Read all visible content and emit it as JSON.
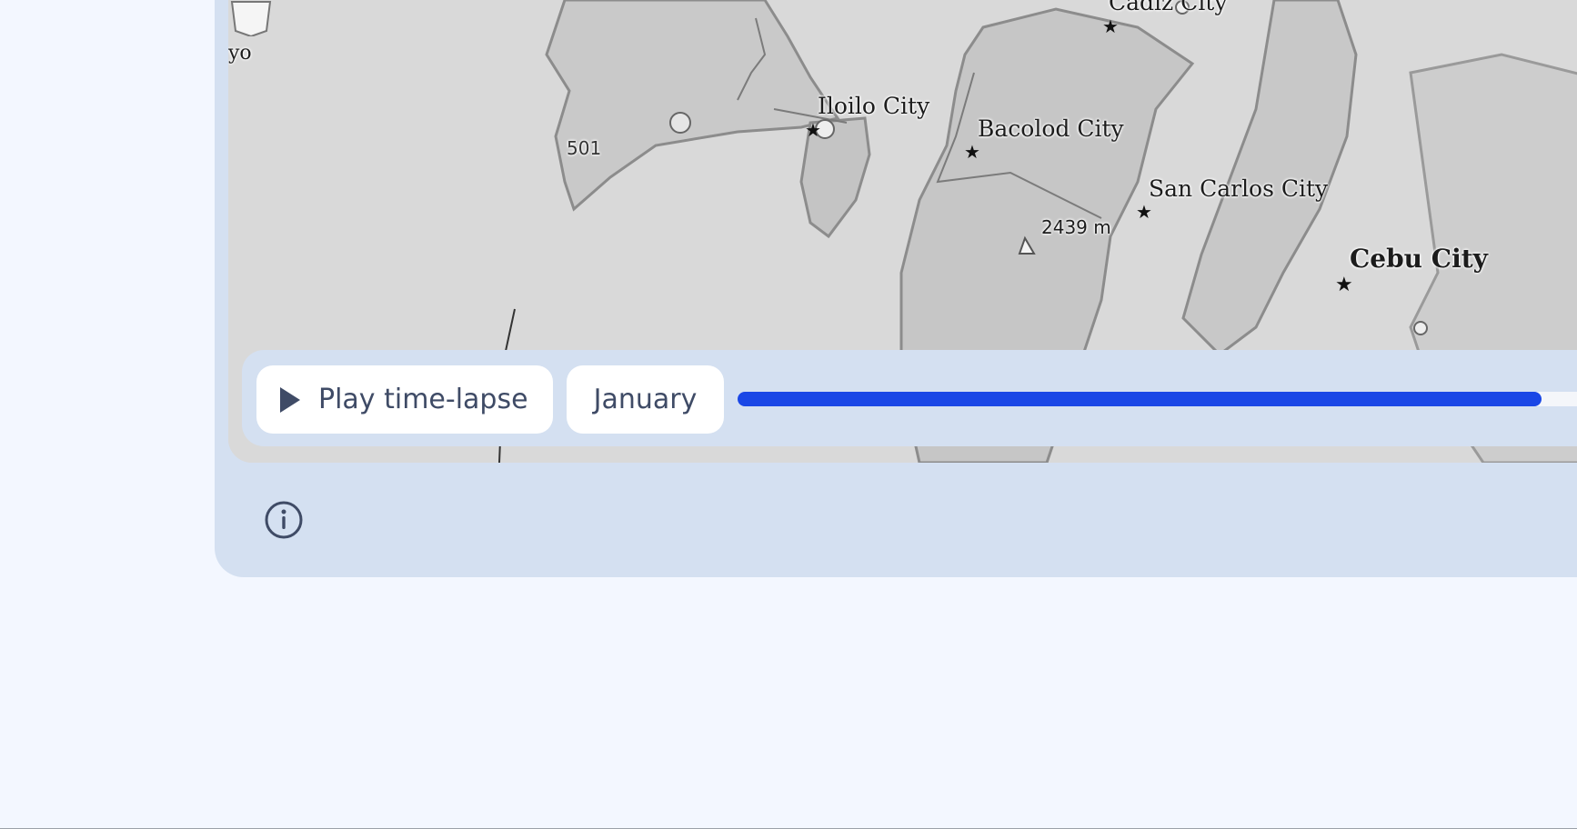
{
  "map": {
    "labels": {
      "yo": "yo",
      "cadiz": "Cadiz City",
      "iloilo": "Iloilo City",
      "bacolod": "Bacolod City",
      "san_carlos": "San Carlos City",
      "elevation": "2439 m",
      "cebu": "Cebu City"
    },
    "route_shield": "501"
  },
  "timeline": {
    "play_label": "Play time-lapse",
    "month": "January",
    "progress_fraction": 0.94,
    "progress_color": "#1a47e6"
  },
  "icons": {
    "play": "play-icon",
    "info": "info-icon"
  }
}
